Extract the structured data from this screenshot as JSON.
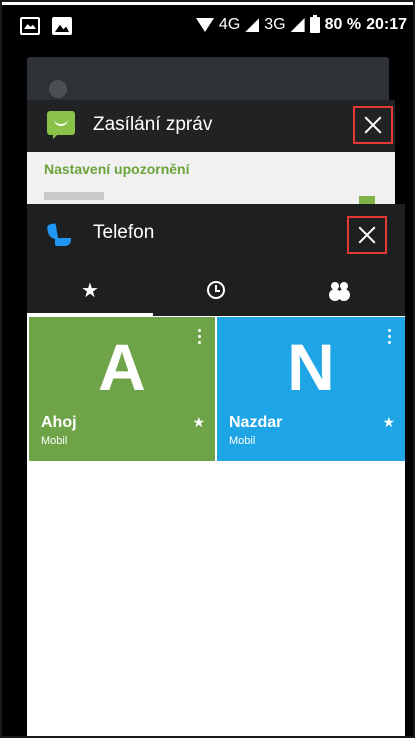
{
  "status_bar": {
    "network": "4G",
    "network2": "3G",
    "battery": "80 %",
    "time": "20:17"
  },
  "recents": {
    "messages_card": {
      "title": "Zasílání zpráv",
      "settings_label": "Nastavení upozornění"
    },
    "phone_card": {
      "title": "Telefon",
      "tabs": [
        {
          "icon": "star-icon",
          "glyph": "★",
          "active": true
        },
        {
          "icon": "clock-icon",
          "active": false
        },
        {
          "icon": "people-icon",
          "active": false
        }
      ],
      "favorites": [
        {
          "letter": "A",
          "name": "Ahoj",
          "type": "Mobil",
          "color": "#6ea447",
          "star": "★"
        },
        {
          "letter": "N",
          "name": "Nazdar",
          "type": "Mobil",
          "color": "#1ea5e6",
          "star": "★"
        }
      ]
    }
  },
  "colors": {
    "close_outline": "#e53935",
    "messaging_green": "#8bc34a",
    "phone_blue": "#2196f3"
  }
}
